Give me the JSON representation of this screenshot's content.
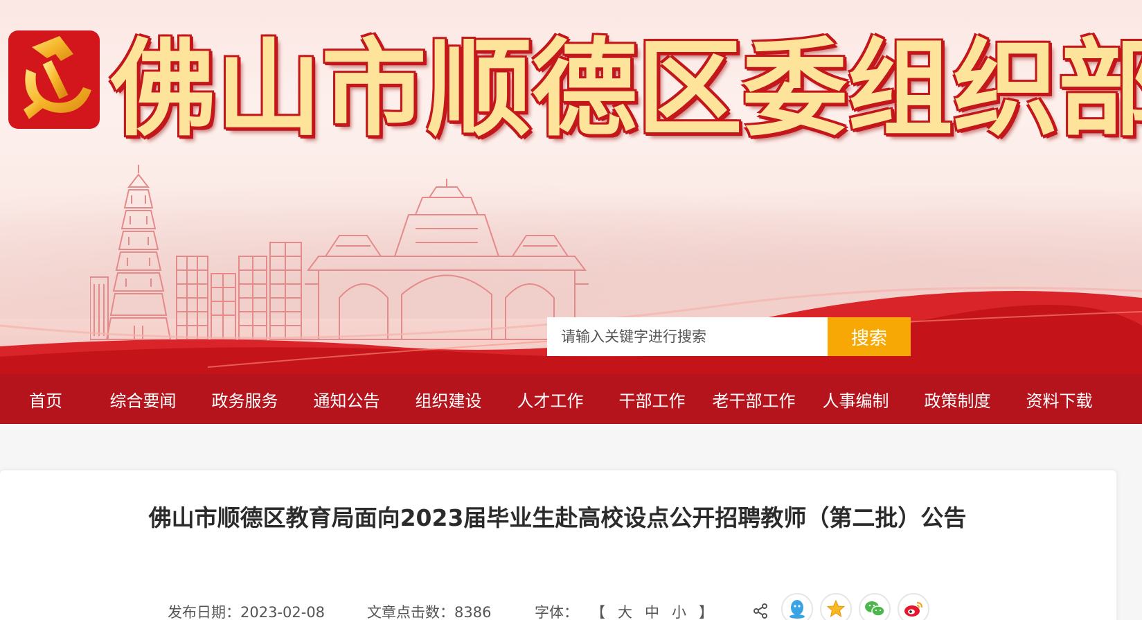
{
  "header": {
    "site_title": "佛山市顺德区委组织部",
    "search": {
      "placeholder": "请输入关键字进行搜索",
      "button_label": "搜索"
    }
  },
  "nav": {
    "items": [
      "首页",
      "综合要闻",
      "政务服务",
      "通知公告",
      "组织建设",
      "人才工作",
      "干部工作",
      "老干部工作",
      "人事编制",
      "政策制度",
      "资料下载"
    ]
  },
  "article": {
    "title": "佛山市顺德区教育局面向2023届毕业生赴高校设点公开招聘教师（第二批）公告",
    "publish_date_label": "发布日期：2023-02-08",
    "views_label": "文章点击数：8386",
    "font_label": "字体：",
    "font_open": "【",
    "font_large": "大",
    "font_medium": "中",
    "font_small": "小",
    "font_close": "】"
  },
  "share": {
    "icons": [
      "share-icon",
      "qq-icon",
      "qzone-icon",
      "wechat-icon",
      "weibo-icon"
    ]
  },
  "colors": {
    "nav_bg": "#b5141c",
    "search_button": "#f8a805",
    "title_fill": "#fde49a",
    "title_outline": "#c4171b"
  }
}
